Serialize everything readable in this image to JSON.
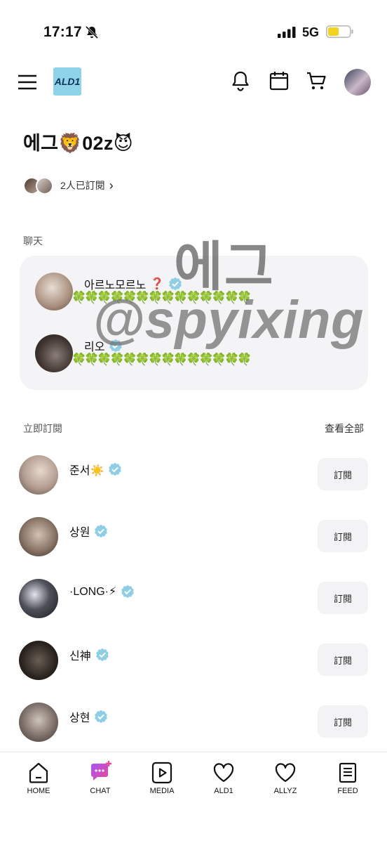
{
  "status_bar": {
    "time": "17:17",
    "network": "5G",
    "battery_color": "#f5d21c"
  },
  "header": {
    "logo_text": "ALD1",
    "icons": [
      "menu-icon",
      "bell-icon",
      "calendar-icon",
      "cart-icon",
      "profile-avatar"
    ]
  },
  "channel": {
    "title": "에그🦁02z😈",
    "subscribers_text": "2人已訂閱"
  },
  "chat": {
    "section_label": "聊天",
    "rooms": [
      {
        "name": "아르노모르노",
        "emoji": "❓",
        "preview": "🍀🍀🍀🍀🍀🍀🍀🍀🍀🍀🍀🍀🍀🍀"
      },
      {
        "name": "리오",
        "emoji": "",
        "preview": "🍀🍀🍀🍀🍀🍀🍀🍀🍀🍀🍀🍀🍀🍀"
      }
    ]
  },
  "watermark": {
    "line1": "에그",
    "line2": "@spyixing"
  },
  "subscribe": {
    "section_label": "立即訂閱",
    "see_all": "查看全部",
    "button_label": "訂閱",
    "artists": [
      {
        "name": "준서☀️"
      },
      {
        "name": "상원"
      },
      {
        "name": "·LONG·⚡"
      },
      {
        "name": "신神"
      },
      {
        "name": "상현"
      }
    ]
  },
  "tabbar": {
    "tabs": [
      {
        "label": "HOME",
        "icon": "home-icon"
      },
      {
        "label": "CHAT",
        "icon": "chat-icon"
      },
      {
        "label": "MEDIA",
        "icon": "play-icon"
      },
      {
        "label": "ALD1",
        "icon": "heart-icon"
      },
      {
        "label": "ALLYZ",
        "icon": "heart-outline-icon"
      },
      {
        "label": "FEED",
        "icon": "feed-icon"
      }
    ]
  },
  "colors": {
    "verified": "#8ecfe6",
    "chat_tab_gradient_start": "#a855f7",
    "chat_tab_gradient_end": "#ec4899"
  }
}
